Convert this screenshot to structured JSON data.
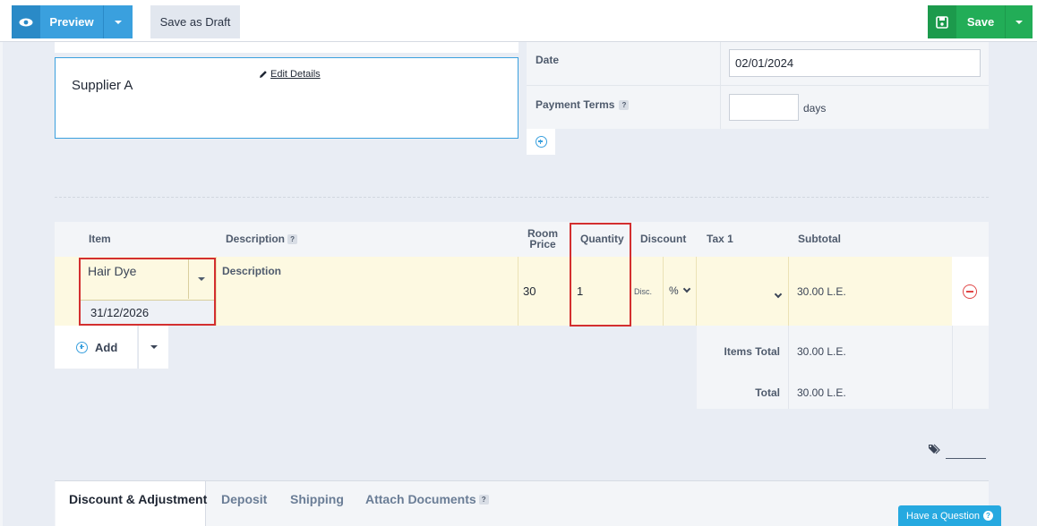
{
  "toolbar": {
    "preview_label": "Preview",
    "draft_label": "Save as Draft",
    "save_label": "Save"
  },
  "supplier": {
    "name": "Supplier A",
    "edit_label": "Edit Details"
  },
  "form": {
    "date_label": "Date",
    "date_value": "02/01/2024",
    "terms_label": "Payment Terms",
    "terms_value": "",
    "days_label": "days"
  },
  "table": {
    "headers": {
      "item": "Item",
      "description": "Description",
      "price_line1": "Room",
      "price_line2": "Price",
      "quantity": "Quantity",
      "discount": "Discount",
      "tax": "Tax 1",
      "subtotal": "Subtotal"
    },
    "row": {
      "item": "Hair Dye",
      "item_date": "31/12/2026",
      "description": "Description",
      "price": "30",
      "quantity": "1",
      "discount_placeholder": "Disc.",
      "discount_type": "%",
      "tax": "",
      "subtotal": "30.00 L.E."
    }
  },
  "add_label": "Add",
  "totals": {
    "items_total_label": "Items Total",
    "items_total_value": "30.00 L.E.",
    "total_label": "Total",
    "total_value": "30.00 L.E."
  },
  "tabs": [
    "Discount & Adjustment",
    "Deposit",
    "Shipping",
    "Attach Documents"
  ],
  "help_button": "Have a Question",
  "colors": {
    "primary": "#3aa0de",
    "save": "#22ad57",
    "highlight": "#d32f2f",
    "row_bg": "#fdf9e1"
  }
}
